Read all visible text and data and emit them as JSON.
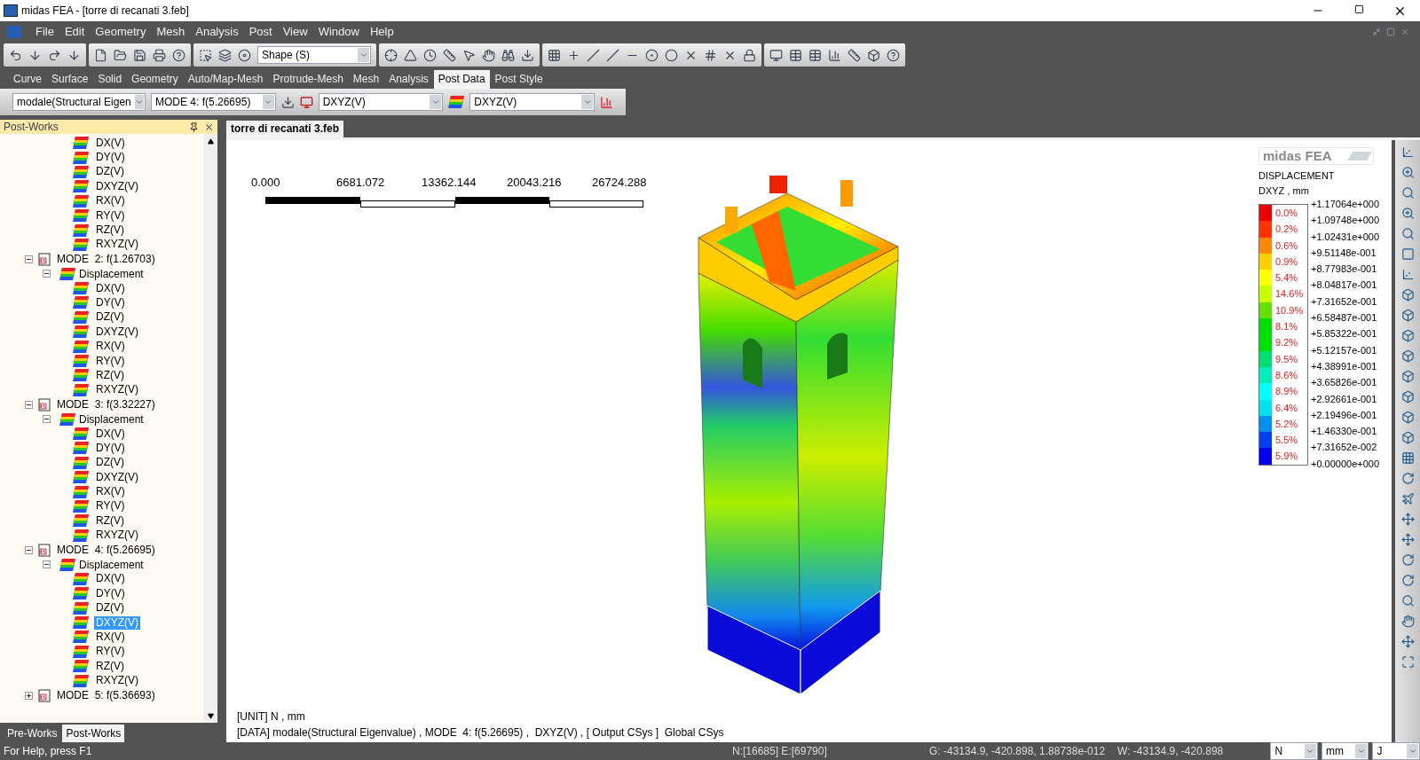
{
  "window": {
    "title": "midas FEA - [torre di recanati 3.feb]"
  },
  "menu": [
    "File",
    "Edit",
    "Geometry",
    "Mesh",
    "Analysis",
    "Post",
    "View",
    "Window",
    "Help"
  ],
  "toolbar": {
    "shape_combo": "Shape (S)"
  },
  "ribbon_tabs": [
    {
      "label": "Curve",
      "selected": false
    },
    {
      "label": "Surface",
      "selected": false
    },
    {
      "label": "Solid",
      "selected": false
    },
    {
      "label": "Geometry",
      "selected": false
    },
    {
      "label": "Auto/Map-Mesh",
      "selected": false
    },
    {
      "label": "Protrude-Mesh",
      "selected": false
    },
    {
      "label": "Mesh",
      "selected": false
    },
    {
      "label": "Analysis",
      "selected": false
    },
    {
      "label": "Post Data",
      "selected": true
    },
    {
      "label": "Post Style",
      "selected": false
    }
  ],
  "post_bar": {
    "load_case": "modale(Structural Eigen",
    "step": "MODE  4: f(5.26695)",
    "component": "DXYZ(V)",
    "component_2": "DXYZ(V)"
  },
  "left_panel": {
    "title": "Post-Works",
    "scrolled_items": [
      {
        "label": "DX(V)",
        "selected": false
      },
      {
        "label": "DY(V)",
        "selected": false
      },
      {
        "label": "DZ(V)",
        "selected": false
      },
      {
        "label": "DXYZ(V)",
        "selected": false
      },
      {
        "label": "RX(V)",
        "selected": false
      },
      {
        "label": "RY(V)",
        "selected": false
      },
      {
        "label": "RZ(V)",
        "selected": false
      },
      {
        "label": "RXYZ(V)",
        "selected": false
      }
    ],
    "modes": [
      {
        "label": "MODE  2: f(1.26703)",
        "expanded": true,
        "children": [
          {
            "label": "Displacement",
            "expanded": true,
            "children": [
              {
                "label": "DX(V)",
                "selected": false
              },
              {
                "label": "DY(V)",
                "selected": false
              },
              {
                "label": "DZ(V)",
                "selected": false
              },
              {
                "label": "DXYZ(V)",
                "selected": false
              },
              {
                "label": "RX(V)",
                "selected": false
              },
              {
                "label": "RY(V)",
                "selected": false
              },
              {
                "label": "RZ(V)",
                "selected": false
              },
              {
                "label": "RXYZ(V)",
                "selected": false
              }
            ]
          }
        ]
      },
      {
        "label": "MODE  3: f(3.32227)",
        "expanded": true,
        "children": [
          {
            "label": "Displacement",
            "expanded": true,
            "children": [
              {
                "label": "DX(V)",
                "selected": false
              },
              {
                "label": "DY(V)",
                "selected": false
              },
              {
                "label": "DZ(V)",
                "selected": false
              },
              {
                "label": "DXYZ(V)",
                "selected": false
              },
              {
                "label": "RX(V)",
                "selected": false
              },
              {
                "label": "RY(V)",
                "selected": false
              },
              {
                "label": "RZ(V)",
                "selected": false
              },
              {
                "label": "RXYZ(V)",
                "selected": false
              }
            ]
          }
        ]
      },
      {
        "label": "MODE  4: f(5.26695)",
        "expanded": true,
        "children": [
          {
            "label": "Displacement",
            "expanded": true,
            "children": [
              {
                "label": "DX(V)",
                "selected": false
              },
              {
                "label": "DY(V)",
                "selected": false
              },
              {
                "label": "DZ(V)",
                "selected": false
              },
              {
                "label": "DXYZ(V)",
                "selected": true
              },
              {
                "label": "RX(V)",
                "selected": false
              },
              {
                "label": "RY(V)",
                "selected": false
              },
              {
                "label": "RZ(V)",
                "selected": false
              },
              {
                "label": "RXYZ(V)",
                "selected": false
              }
            ]
          }
        ]
      },
      {
        "label": "MODE  5: f(5.36693)",
        "expanded": false
      }
    ],
    "tabs": [
      {
        "label": "Pre-Works",
        "selected": false
      },
      {
        "label": "Post-Works",
        "selected": true
      }
    ]
  },
  "document_tab": "torre di recanati 3.feb",
  "viewport": {
    "scale_bar": [
      "0.000",
      "6681.072",
      "13362.144",
      "20043.216",
      "26724.288"
    ],
    "logo": "midas FEA",
    "legend": {
      "title": "DISPLACEMENT",
      "subtitle": "DXYZ , mm",
      "values": [
        "+1.17064e+000",
        "+1.09748e+000",
        "+1.02431e+000",
        "+9.51148e-001",
        "+8.77983e-001",
        "+8.04817e-001",
        "+7.31652e-001",
        "+6.58487e-001",
        "+5.85322e-001",
        "+5.12157e-001",
        "+4.38991e-001",
        "+3.65826e-001",
        "+2.92661e-001",
        "+2.19496e-001",
        "+1.46330e-001",
        "+7.31652e-002",
        "+0.00000e+000"
      ],
      "bands": [
        {
          "percent": "0.0%",
          "color": "#ee0000"
        },
        {
          "percent": "0.2%",
          "color": "#ff3300"
        },
        {
          "percent": "0.6%",
          "color": "#ff8800"
        },
        {
          "percent": "0.9%",
          "color": "#ffd000"
        },
        {
          "percent": "5.4%",
          "color": "#ffff00"
        },
        {
          "percent": "14.6%",
          "color": "#c8ff00"
        },
        {
          "percent": "10.9%",
          "color": "#66e000"
        },
        {
          "percent": "8.1%",
          "color": "#00dd00"
        },
        {
          "percent": "9.2%",
          "color": "#00e000"
        },
        {
          "percent": "9.5%",
          "color": "#00e070"
        },
        {
          "percent": "8.6%",
          "color": "#00eebb"
        },
        {
          "percent": "8.9%",
          "color": "#00ffff"
        },
        {
          "percent": "6.4%",
          "color": "#00e0f0"
        },
        {
          "percent": "5.2%",
          "color": "#0090f0"
        },
        {
          "percent": "5.5%",
          "color": "#0040f0"
        },
        {
          "percent": "5.9%",
          "color": "#0000ee"
        }
      ]
    },
    "info": [
      "[UNIT] N , mm",
      "[DATA] modale(Structural Eigenvalue) , MODE  4: f(5.26695) ,  DXYZ(V) , [ Output CSys ]  Global CSys"
    ]
  },
  "status_bar": {
    "help": "For Help, press F1",
    "counts": "N:[16685] E:[69790]",
    "global": "G: -43134.9, -420.898, 1.88738e-012",
    "work": "W: -43134.9, -420.898",
    "units": [
      "N",
      "mm",
      "J"
    ]
  }
}
